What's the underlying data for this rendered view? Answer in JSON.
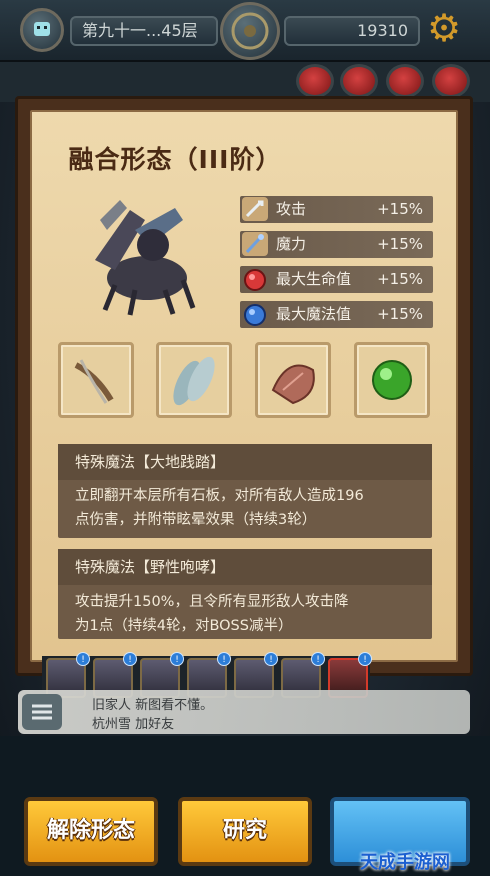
{
  "top": {
    "floor_label": "第九十一...45层",
    "gold": "19310"
  },
  "panel": {
    "title": "融合形态（III阶）",
    "stats": [
      {
        "name": "攻击",
        "value": "+15%",
        "icon": "sword-icon",
        "color": "#b7c0c6"
      },
      {
        "name": "魔力",
        "value": "+15%",
        "icon": "staff-icon",
        "color": "#7fa7d9"
      },
      {
        "name": "最大生命值",
        "value": "+15%",
        "icon": "red-potion-icon",
        "color": "#d83838"
      },
      {
        "name": "最大魔法值",
        "value": "+15%",
        "icon": "blue-potion-icon",
        "color": "#3a7ad8"
      }
    ],
    "items": [
      {
        "name": "claw-item"
      },
      {
        "name": "wing-item"
      },
      {
        "name": "shell-item"
      },
      {
        "name": "green-orb-item",
        "color": "#3aa52a"
      }
    ],
    "skills": [
      {
        "title": "特殊魔法【大地践踏】",
        "line1": "立即翻开本层所有石板，对所有敌人造成196",
        "line2": "点伤害，并附带眩晕效果（持续3轮）"
      },
      {
        "title": "特殊魔法【野性咆哮】",
        "line1": "攻击提升150%，且令所有显形敌人攻击降",
        "line2": "为1点（持续4轮，对BOSS减半）"
      }
    ]
  },
  "chat": {
    "line1": "旧家人  新图看不懂。",
    "line2": "杭州雪  加好友"
  },
  "buttons": {
    "release_label": "解除形态",
    "research_label": "研究"
  },
  "watermark": "天成手游网"
}
